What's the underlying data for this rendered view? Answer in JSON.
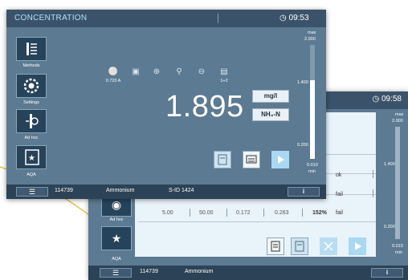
{
  "colors": {
    "accent": "#aee0f6",
    "panel": "#5c7a91",
    "bar": "#2b4257",
    "titlebar": "#3b536a"
  },
  "back": {
    "time": "09:58",
    "rows": [
      {
        "result": "ok"
      },
      {
        "result": "fail"
      },
      {
        "c1": "5.00",
        "c2": "50.00",
        "c3": "0.172",
        "c4": "0.263",
        "pct": "152%",
        "result": "fail"
      }
    ],
    "sidebar": [
      {
        "label": "Ad hoc",
        "icon": "adhoc-icon"
      },
      {
        "label": "AQA",
        "icon": "aqa-icon"
      }
    ],
    "scale": {
      "max_label": "max",
      "max": "2.000",
      "mid": "1.400",
      "low": "0.200",
      "min": "0.010",
      "min_label": "min"
    },
    "bottom": {
      "id": "114739",
      "name": "Ammonium",
      "info": "i"
    }
  },
  "front": {
    "title": "CONCENTRATION",
    "time": "09:53",
    "sidebar": [
      {
        "label": "Methods",
        "icon": "methods-icon"
      },
      {
        "label": "Settings",
        "icon": "settings-icon"
      },
      {
        "label": "Ad hoc",
        "icon": "adhoc-icon"
      },
      {
        "label": "AQA",
        "icon": "aqa-icon"
      }
    ],
    "status_icons": [
      {
        "icon": "absorbance-icon",
        "label": "0.720 A"
      },
      {
        "icon": "calendar-icon",
        "label": ""
      },
      {
        "icon": "filter-icon",
        "label": ""
      },
      {
        "icon": "temperature-icon",
        "label": ""
      },
      {
        "icon": "lamp-icon",
        "label": ""
      },
      {
        "icon": "dilution-icon",
        "label": "1+2"
      }
    ],
    "value": "1.895",
    "unit": "mg/l",
    "form": "NH₄-N",
    "scale": {
      "max_label": "max",
      "max": "2.000",
      "mid": "1.400",
      "low": "0.200",
      "min": "0.010",
      "min_label": "min"
    },
    "bottom": {
      "id": "114739",
      "name": "Ammonium",
      "sid": "S-ID 1424",
      "info": "i"
    }
  }
}
